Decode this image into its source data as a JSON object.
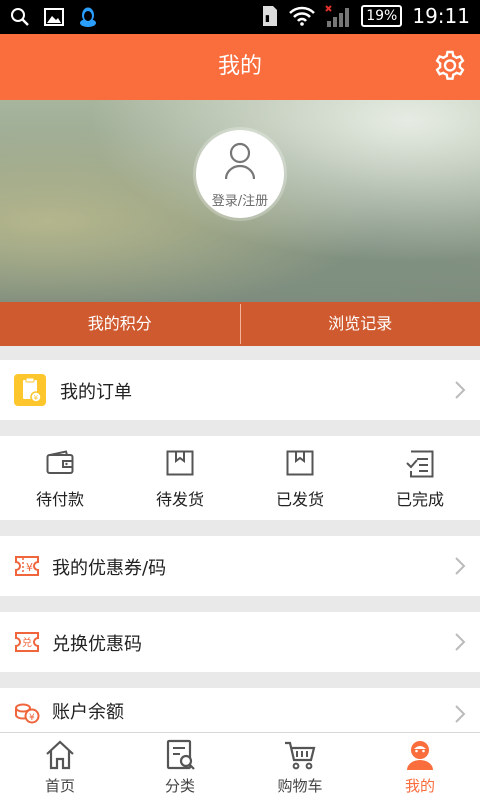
{
  "status_bar": {
    "battery": "19%",
    "time": "19:11"
  },
  "header": {
    "title": "我的"
  },
  "profile": {
    "login_label": "登录/注册"
  },
  "subtabs": [
    {
      "label": "我的积分"
    },
    {
      "label": "浏览记录"
    }
  ],
  "orders": {
    "label": "我的订单"
  },
  "order_status": [
    {
      "label": "待付款",
      "icon": "wallet-icon"
    },
    {
      "label": "待发货",
      "icon": "box-icon"
    },
    {
      "label": "已发货",
      "icon": "box-icon"
    },
    {
      "label": "已完成",
      "icon": "checklist-icon"
    }
  ],
  "menu": {
    "coupon": "我的优惠券/码",
    "exchange": "兑换优惠码",
    "balance": "账户余额"
  },
  "bottom_nav": [
    {
      "label": "首页",
      "icon": "home-icon"
    },
    {
      "label": "分类",
      "icon": "category-icon"
    },
    {
      "label": "购物车",
      "icon": "cart-icon"
    },
    {
      "label": "我的",
      "icon": "profile-icon",
      "active": true
    }
  ],
  "colors": {
    "accent": "#fa6d3c",
    "subtab_bg": "#cf5a2f",
    "order_icon": "#fcc62c"
  }
}
